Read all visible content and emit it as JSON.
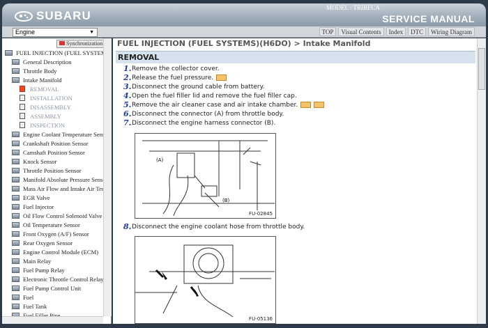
{
  "header": {
    "brand": "SUBARU",
    "model": "MODEL : TRIBECA",
    "title": "SERVICE MANUAL"
  },
  "toolbar": {
    "category": "Engine",
    "tabs": [
      "TOP",
      "Visual Contents",
      "Index",
      "DTC",
      "Wiring Diagram"
    ]
  },
  "sidebar": {
    "sync_label": "Synchronization",
    "items": [
      {
        "label": "FUEL INJECTION (FUEL SYSTEM",
        "level": 0,
        "icon": "open-folder-icon"
      },
      {
        "label": "General Description",
        "level": 1,
        "icon": "folder-icon"
      },
      {
        "label": "Throttle Body",
        "level": 1,
        "icon": "folder-icon"
      },
      {
        "label": "Intake Manifold",
        "level": 1,
        "icon": "open-folder-icon"
      },
      {
        "label": "REMOVAL",
        "level": 2,
        "icon": "active-document-icon"
      },
      {
        "label": "INSTALLATION",
        "level": 2,
        "icon": "document-icon"
      },
      {
        "label": "DISASSEMBLY",
        "level": 2,
        "icon": "document-icon"
      },
      {
        "label": "ASSEMBLY",
        "level": 2,
        "icon": "document-icon"
      },
      {
        "label": "INSPECTION",
        "level": 2,
        "icon": "document-icon"
      },
      {
        "label": "Engine Coolant Temperature Sensor",
        "level": 1,
        "icon": "folder-icon"
      },
      {
        "label": "Crankshaft Position Sensor",
        "level": 1,
        "icon": "folder-icon"
      },
      {
        "label": "Camshaft Position Sensor",
        "level": 1,
        "icon": "folder-icon"
      },
      {
        "label": "Knock Sensor",
        "level": 1,
        "icon": "folder-icon"
      },
      {
        "label": "Throttle Position Sensor",
        "level": 1,
        "icon": "folder-icon"
      },
      {
        "label": "Manifold Absolute Pressure Sensor",
        "level": 1,
        "icon": "folder-icon"
      },
      {
        "label": "Mass Air Flow and Intake Air Temperature Sensor",
        "level": 1,
        "icon": "folder-icon"
      },
      {
        "label": "EGR Valve",
        "level": 1,
        "icon": "folder-icon"
      },
      {
        "label": "Fuel Injector",
        "level": 1,
        "icon": "folder-icon"
      },
      {
        "label": "Oil Flow Control Solenoid Valve",
        "level": 1,
        "icon": "folder-icon"
      },
      {
        "label": "Oil Temperature Sensor",
        "level": 1,
        "icon": "folder-icon"
      },
      {
        "label": "Front Oxygen (A/F) Sensor",
        "level": 1,
        "icon": "folder-icon"
      },
      {
        "label": "Rear Oxygen Sensor",
        "level": 1,
        "icon": "folder-icon"
      },
      {
        "label": "Engine Control Module (ECM)",
        "level": 1,
        "icon": "folder-icon"
      },
      {
        "label": "Main Relay",
        "level": 1,
        "icon": "folder-icon"
      },
      {
        "label": "Fuel Pump Relay",
        "level": 1,
        "icon": "folder-icon"
      },
      {
        "label": "Electronic Throttle Control Relay",
        "level": 1,
        "icon": "folder-icon"
      },
      {
        "label": "Fuel Pump Control Unit",
        "level": 1,
        "icon": "folder-icon"
      },
      {
        "label": "Fuel",
        "level": 1,
        "icon": "folder-icon"
      },
      {
        "label": "Fuel Tank",
        "level": 1,
        "icon": "folder-icon"
      },
      {
        "label": "Fuel Filler Pipe",
        "level": 1,
        "icon": "folder-icon"
      }
    ]
  },
  "content": {
    "breadcrumb": "FUEL INJECTION (FUEL SYSTEMS)(H6DO) > Intake Manifold",
    "section": "REMOVAL",
    "steps": [
      {
        "num": "1.",
        "text": "Remove the collector cover.",
        "refs": 0
      },
      {
        "num": "2.",
        "text": "Release the fuel pressure.",
        "refs": 1
      },
      {
        "num": "3.",
        "text": "Disconnect the ground cable from battery.",
        "refs": 0
      },
      {
        "num": "4.",
        "text": "Open the fuel filler lid and remove the fuel filler cap.",
        "refs": 0
      },
      {
        "num": "5.",
        "text": "Remove the air cleaner case and air intake chamber.",
        "refs": 2
      },
      {
        "num": "6.",
        "text": "Disconnect the connector (A) from throttle body.",
        "refs": 0
      },
      {
        "num": "7.",
        "text": "Disconnect the engine harness connector (B).",
        "refs": 0
      }
    ],
    "figure1": {
      "id": "FU-02845",
      "label_a": "(A)",
      "label_b": "(B)"
    },
    "step8": {
      "num": "8.",
      "text": "Disconnect the engine coolant hose from throttle body."
    },
    "figure2": {
      "id": "FU-05136"
    }
  }
}
